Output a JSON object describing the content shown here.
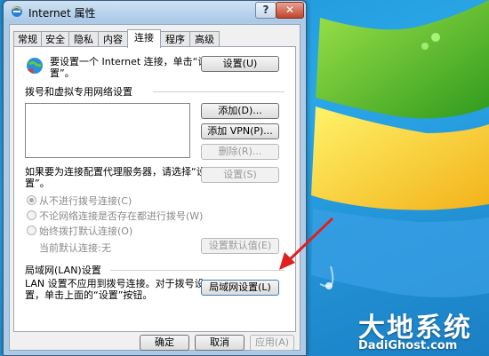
{
  "window": {
    "title": "Internet 属性",
    "help_label": "?",
    "close_label": "✕"
  },
  "tabs": [
    {
      "label": "常规"
    },
    {
      "label": "安全"
    },
    {
      "label": "隐私"
    },
    {
      "label": "内容"
    },
    {
      "label": "连接",
      "active": true
    },
    {
      "label": "程序"
    },
    {
      "label": "高级"
    }
  ],
  "connect": {
    "setup_line1": "要设置一个 Internet 连接，单击“设",
    "setup_line2": "置”。",
    "setup_button": "设置(U)"
  },
  "dialup": {
    "group_label": "拨号和虚拟专用网络设置",
    "add_button": "添加(D)...",
    "add_vpn_button": "添加 VPN(P)...",
    "remove_button": "删除(R)...",
    "proxy_line1": "如果要为连接配置代理服务器，请选择“设",
    "proxy_line2": "置”。",
    "settings_button": "设置(S)",
    "radio_never": "从不进行拨号连接(C)",
    "radio_when_none": "不论网络连接是否存在都进行拨号(W)",
    "radio_always": "始终拨打默认连接(O)",
    "current_default_label": "当前默认连接:",
    "current_default_value": "无",
    "set_default_button": "设置默认值(E)"
  },
  "lan": {
    "group_label": "局域网(LAN)设置",
    "desc_line1": "LAN 设置不应用到拨号连接。对于拨号设",
    "desc_line2": "置，单击上面的“设置”按钮。",
    "lan_settings_button": "局域网设置(L)"
  },
  "footer": {
    "ok_button": "确定",
    "cancel_button": "取消",
    "apply_button": "应用(A)"
  },
  "watermark": {
    "title": "大地系统",
    "url": "DadiGhost.com"
  },
  "colors": {
    "arrow": "#e02020",
    "close": "#c2432b",
    "desktop": "#1e93d6"
  }
}
